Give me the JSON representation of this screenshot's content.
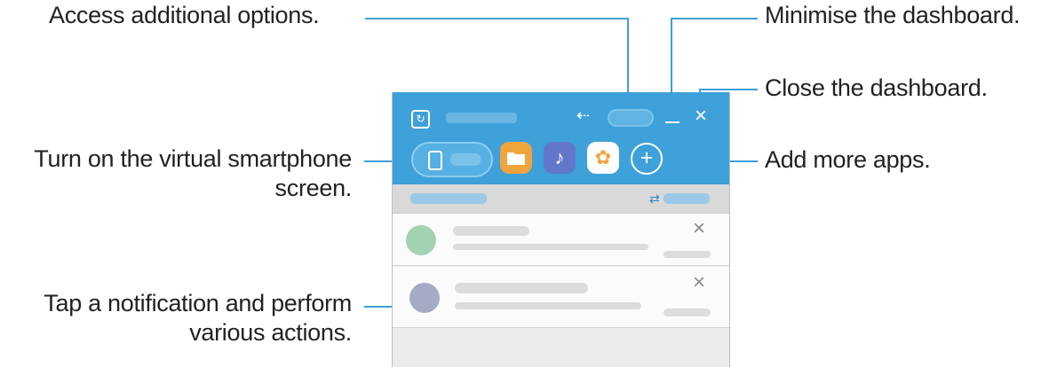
{
  "labels": {
    "access": "Access additional options.",
    "minimise": "Minimise the dashboard.",
    "close": "Close the dashboard.",
    "virtual_line1": "Turn on the virtual smartphone",
    "virtual_line2": "screen.",
    "add_apps": "Add more apps.",
    "tap_line1": "Tap a notification and perform",
    "tap_line2": "various actions."
  },
  "icons": {
    "usb": "⇠",
    "close": "×",
    "music": "♪",
    "gallery": "✿",
    "add": "+"
  },
  "colors": {
    "accent": "#3ea1d9",
    "callout_line": "#3f9fd6"
  }
}
